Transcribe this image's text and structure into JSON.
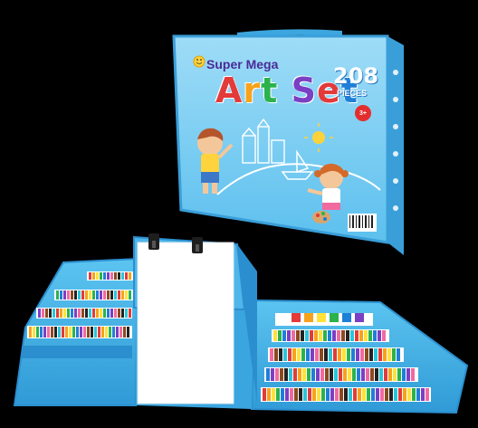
{
  "box": {
    "line1": "Super Mega",
    "line2_letters": [
      "A",
      "r",
      "t",
      " ",
      "S",
      "e",
      "t"
    ],
    "line2_colors": [
      "#e33a3a",
      "#f7a21b",
      "#2bb24c",
      "#ffffff",
      "#7b3fc4",
      "#e33a3a",
      "#1e7fd8"
    ],
    "count": "208",
    "count_label": "PIECES",
    "age": "3+"
  },
  "colors": {
    "case_blue": "#4fb6ea",
    "case_dark": "#2b8fcf",
    "paper": "#ffffff",
    "background": "#000000"
  },
  "icons": {
    "smiley": "smiley-icon",
    "easel": "easel-icon"
  }
}
